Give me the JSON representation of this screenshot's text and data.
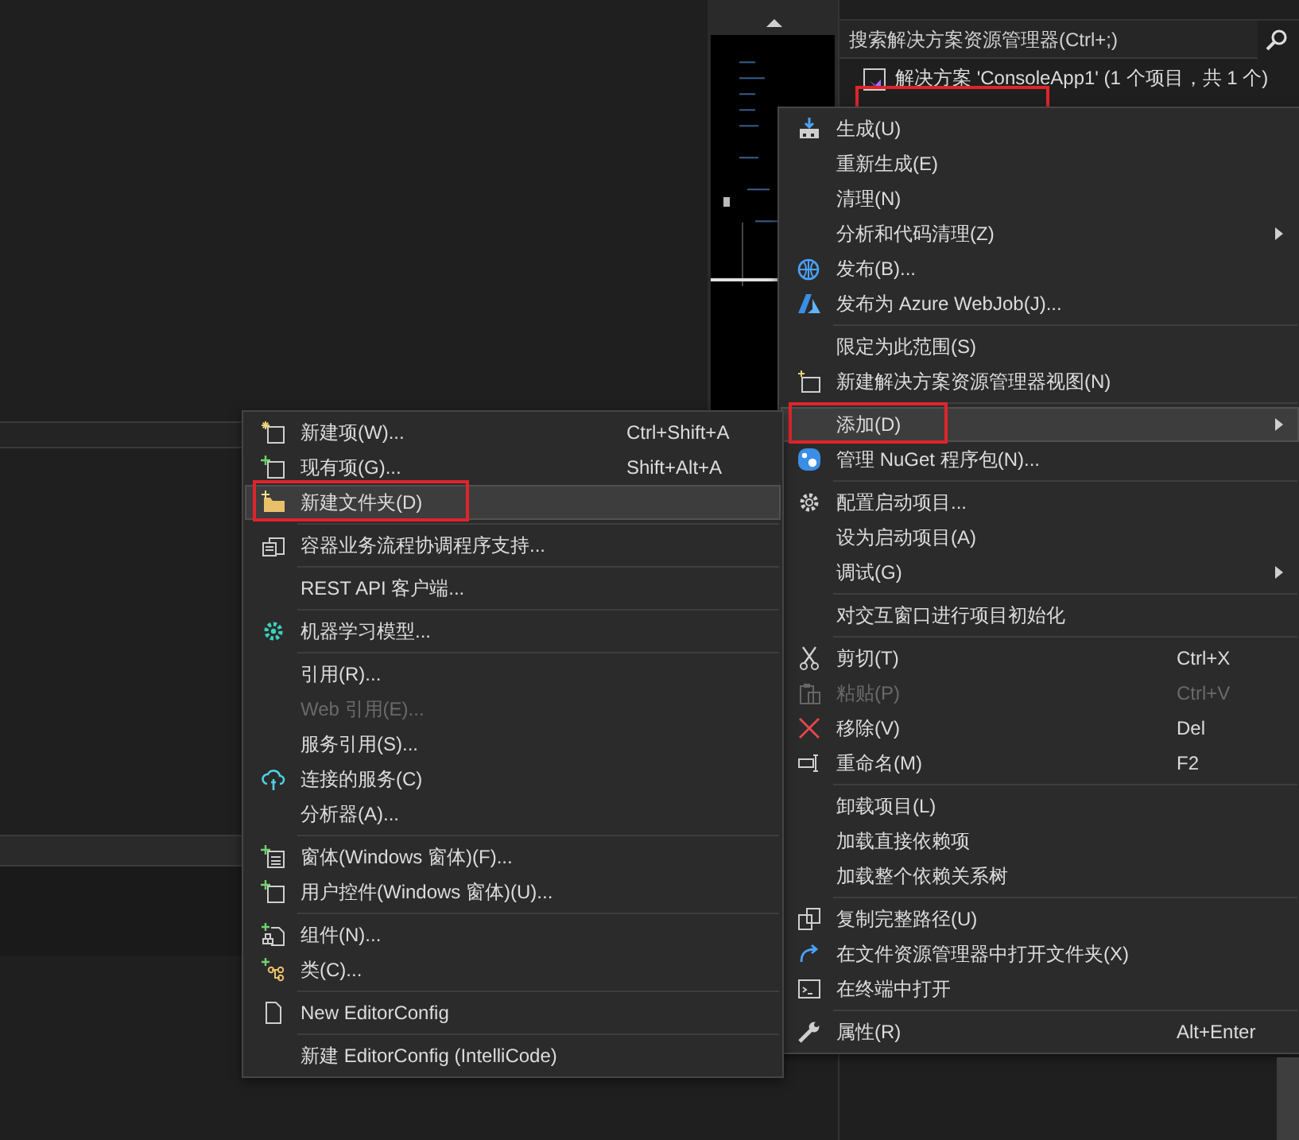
{
  "solution_explorer": {
    "search": {
      "placeholder": "搜索解决方案资源管理器(Ctrl+;)"
    },
    "solution_row": {
      "label": "解决方案 'ConsoleApp1' (1 个项目，共 1 个)"
    },
    "project_row": {
      "marked": true
    }
  },
  "context_menu": {
    "groups": [
      [
        {
          "label": "生成(U)",
          "submenu": false,
          "selected": false,
          "disabled": false,
          "marked": false
        },
        {
          "label": "重新生成(E)",
          "submenu": false,
          "selected": false,
          "disabled": false,
          "marked": false
        },
        {
          "label": "清理(N)",
          "submenu": false,
          "selected": false,
          "disabled": false,
          "marked": false
        },
        {
          "label": "分析和代码清理(Z)",
          "submenu": true,
          "selected": false,
          "disabled": false,
          "marked": false
        },
        {
          "label": "发布(B)...",
          "submenu": false,
          "selected": false,
          "disabled": false,
          "marked": false
        },
        {
          "label": "发布为 Azure WebJob(J)...",
          "submenu": false,
          "selected": false,
          "disabled": false,
          "marked": false
        }
      ],
      [
        {
          "label": "限定为此范围(S)",
          "submenu": false,
          "selected": false,
          "disabled": false,
          "marked": false
        },
        {
          "label": "新建解决方案资源管理器视图(N)",
          "submenu": false,
          "selected": false,
          "disabled": false,
          "marked": false
        }
      ],
      [
        {
          "label": "添加(D)",
          "submenu": true,
          "selected": true,
          "disabled": false,
          "marked": true
        },
        {
          "label": "管理 NuGet 程序包(N)...",
          "submenu": false,
          "selected": false,
          "disabled": false,
          "marked": false
        }
      ],
      [
        {
          "label": "配置启动项目...",
          "submenu": false,
          "selected": false,
          "disabled": false,
          "marked": false
        },
        {
          "label": "设为启动项目(A)",
          "submenu": false,
          "selected": false,
          "disabled": false,
          "marked": false
        },
        {
          "label": "调试(G)",
          "submenu": true,
          "selected": false,
          "disabled": false,
          "marked": false
        }
      ],
      [
        {
          "label": "对交互窗口进行项目初始化",
          "submenu": false,
          "selected": false,
          "disabled": false,
          "marked": false
        }
      ],
      [
        {
          "label": "剪切(T)",
          "shortcut": "Ctrl+X",
          "submenu": false,
          "selected": false,
          "disabled": false,
          "marked": false
        },
        {
          "label": "粘贴(P)",
          "shortcut": "Ctrl+V",
          "submenu": false,
          "selected": false,
          "disabled": true,
          "marked": false
        },
        {
          "label": "移除(V)",
          "shortcut": "Del",
          "submenu": false,
          "selected": false,
          "disabled": false,
          "marked": false
        },
        {
          "label": "重命名(M)",
          "shortcut": "F2",
          "submenu": false,
          "selected": false,
          "disabled": false,
          "marked": false
        }
      ],
      [
        {
          "label": "卸载项目(L)",
          "submenu": false,
          "selected": false,
          "disabled": false,
          "marked": false
        },
        {
          "label": "加载直接依赖项",
          "submenu": false,
          "selected": false,
          "disabled": false,
          "marked": false
        },
        {
          "label": "加载整个依赖关系树",
          "submenu": false,
          "selected": false,
          "disabled": false,
          "marked": false
        }
      ],
      [
        {
          "label": "复制完整路径(U)",
          "submenu": false,
          "selected": false,
          "disabled": false,
          "marked": false
        },
        {
          "label": "在文件资源管理器中打开文件夹(X)",
          "submenu": false,
          "selected": false,
          "disabled": false,
          "marked": false
        },
        {
          "label": "在终端中打开",
          "submenu": false,
          "selected": false,
          "disabled": false,
          "marked": false
        }
      ],
      [
        {
          "label": "属性(R)",
          "shortcut": "Alt+Enter",
          "submenu": false,
          "selected": false,
          "disabled": false,
          "marked": false
        }
      ]
    ]
  },
  "add_submenu": {
    "groups": [
      [
        {
          "label": "新建项(W)...",
          "shortcut": "Ctrl+Shift+A",
          "submenu": false,
          "selected": false,
          "disabled": false,
          "marked": false
        },
        {
          "label": "现有项(G)...",
          "shortcut": "Shift+Alt+A",
          "submenu": false,
          "selected": false,
          "disabled": false,
          "marked": false
        },
        {
          "label": "新建文件夹(D)",
          "submenu": false,
          "selected": true,
          "disabled": false,
          "marked": true
        }
      ],
      [
        {
          "label": "容器业务流程协调程序支持...",
          "submenu": false,
          "selected": false,
          "disabled": false,
          "marked": false
        }
      ],
      [
        {
          "label": "REST API 客户端...",
          "submenu": false,
          "selected": false,
          "disabled": false,
          "marked": false
        }
      ],
      [
        {
          "label": "机器学习模型...",
          "submenu": false,
          "selected": false,
          "disabled": false,
          "marked": false
        }
      ],
      [
        {
          "label": "引用(R)...",
          "submenu": false,
          "selected": false,
          "disabled": false,
          "marked": false
        },
        {
          "label": "Web 引用(E)...",
          "submenu": false,
          "selected": false,
          "disabled": true,
          "marked": false
        },
        {
          "label": "服务引用(S)...",
          "submenu": false,
          "selected": false,
          "disabled": false,
          "marked": false
        },
        {
          "label": "连接的服务(C)",
          "submenu": false,
          "selected": false,
          "disabled": false,
          "marked": false
        },
        {
          "label": "分析器(A)...",
          "submenu": false,
          "selected": false,
          "disabled": false,
          "marked": false
        }
      ],
      [
        {
          "label": "窗体(Windows 窗体)(F)...",
          "submenu": false,
          "selected": false,
          "disabled": false,
          "marked": false
        },
        {
          "label": "用户控件(Windows 窗体)(U)...",
          "submenu": false,
          "selected": false,
          "disabled": false,
          "marked": false
        }
      ],
      [
        {
          "label": "组件(N)...",
          "submenu": false,
          "selected": false,
          "disabled": false,
          "marked": false
        },
        {
          "label": "类(C)...",
          "submenu": false,
          "selected": false,
          "disabled": false,
          "marked": false
        }
      ],
      [
        {
          "label": "New EditorConfig",
          "submenu": false,
          "selected": false,
          "disabled": false,
          "marked": false
        }
      ],
      [
        {
          "label": "新建 EditorConfig (IntelliCode)",
          "submenu": false,
          "selected": false,
          "disabled": false,
          "marked": false
        }
      ]
    ]
  }
}
